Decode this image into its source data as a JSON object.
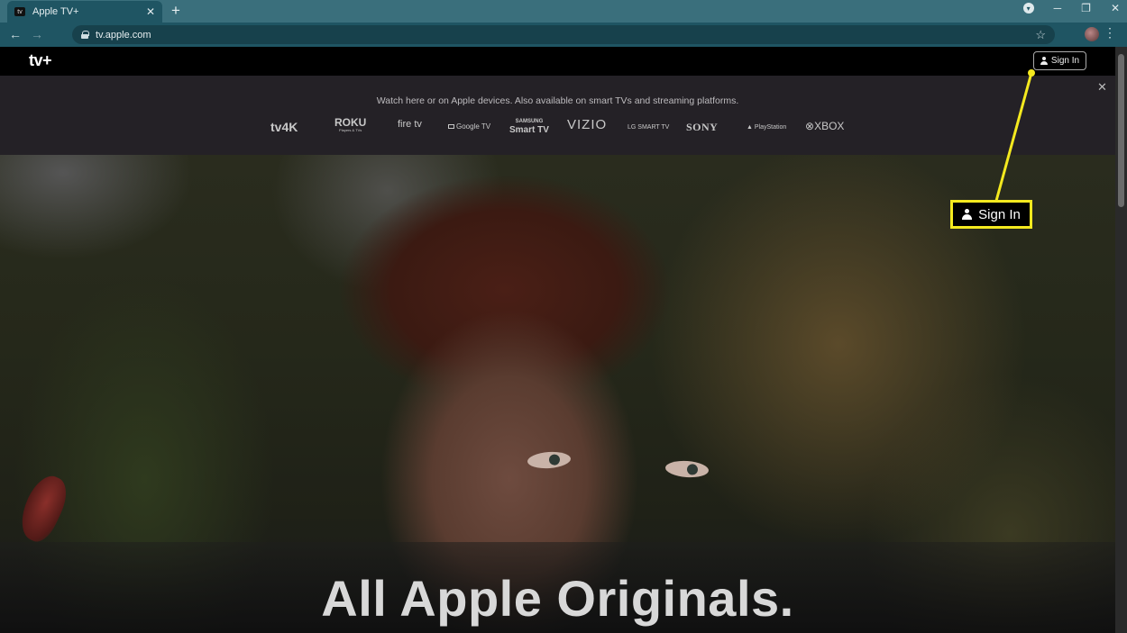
{
  "browser": {
    "tab_title": "Apple TV+",
    "tab_close": "✕",
    "new_tab": "+",
    "url": "tv.apple.com",
    "icons": [
      "back-icon",
      "forward-icon",
      "lock-icon",
      "star-icon",
      "profile-avatar",
      "menu-icon",
      "tab-search-icon",
      "minimize-icon",
      "restore-icon",
      "close-icon"
    ]
  },
  "header": {
    "logo": "tv+",
    "signin_label": "Sign In"
  },
  "banner": {
    "text": "Watch here or on Apple devices. Also available on smart TVs and streaming platforms.",
    "platforms": [
      "tv4K",
      "ROKU",
      "fire tv",
      "Google TV",
      "SAMSUNG Smart TV",
      "VIZIO",
      "LG SMART TV",
      "SONY",
      "PlayStation",
      "XBOX"
    ],
    "roku_sub": "Players & TVs",
    "samsung_top": "SAMSUNG",
    "samsung_bottom": "Smart TV"
  },
  "hero": {
    "title": "All Apple Originals."
  },
  "callout": {
    "label": "Sign In",
    "color": "#f4e91f"
  }
}
